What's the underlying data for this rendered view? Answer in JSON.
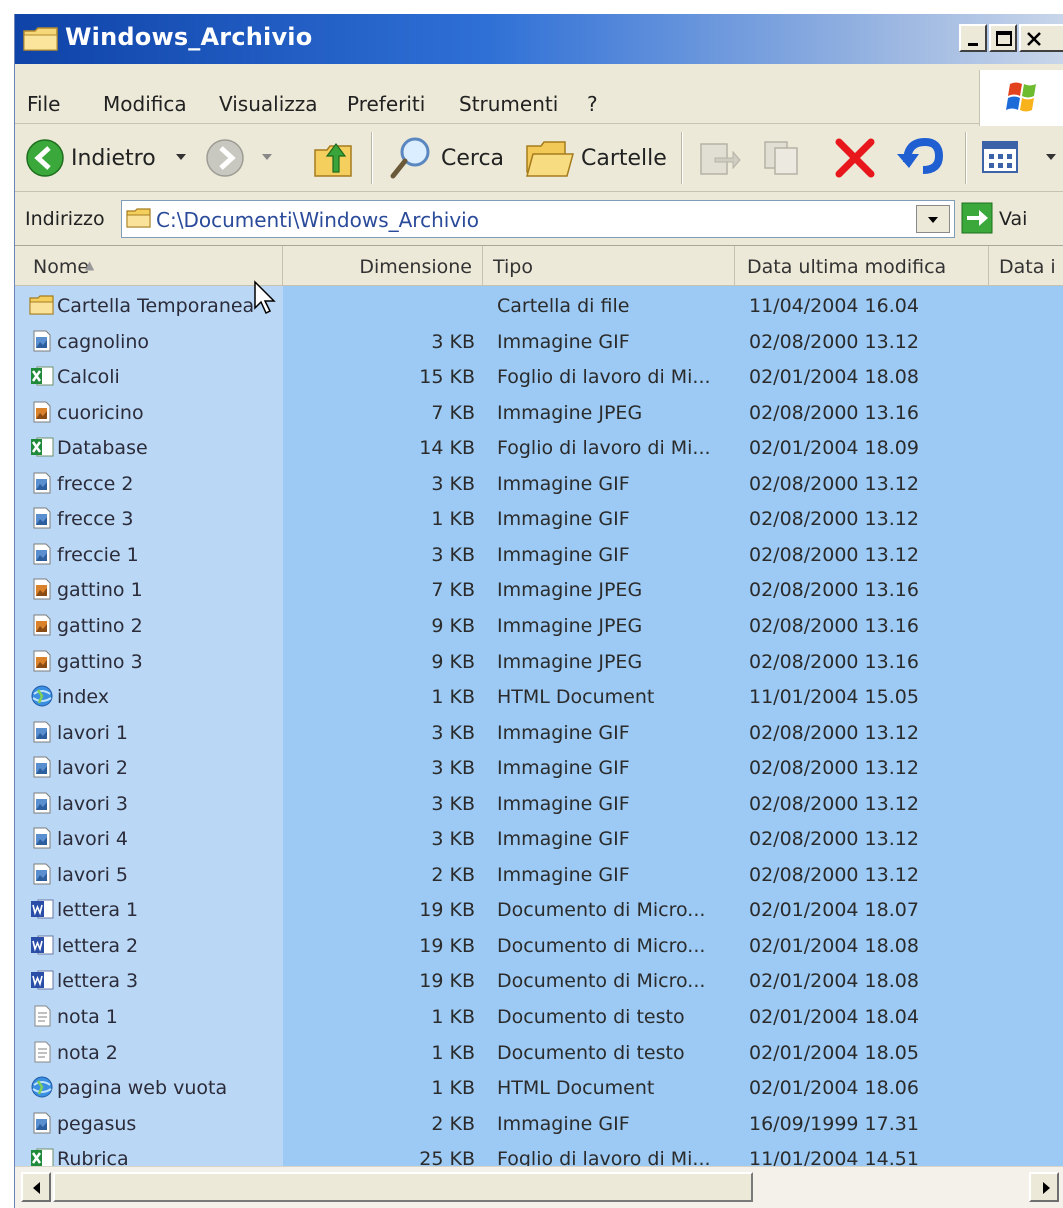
{
  "window": {
    "title": "Windows_Archivio",
    "colors": {
      "title_start": "#0f43a8",
      "title_end": "#c9d6ea",
      "list_background": "#9ccaf4",
      "name_column_background": "#bad8f5",
      "delete_red": "#e8171c"
    }
  },
  "menu": [
    "File",
    "Modifica",
    "Visualizza",
    "Preferiti",
    "Strumenti",
    "?"
  ],
  "toolbar": {
    "back_label": "Indietro",
    "search_label": "Cerca",
    "folders_label": "Cartelle"
  },
  "address": {
    "label": "Indirizzo",
    "path": "C:\\Documenti\\Windows_Archivio",
    "go_label": "Vai"
  },
  "columns": {
    "name": "Nome",
    "size": "Dimensione",
    "type": "Tipo",
    "modified": "Data ultima modifica",
    "created": "Data i"
  },
  "files": [
    {
      "name": "Cartella Temporanea",
      "size": "",
      "type": "Cartella di file",
      "date": "11/04/2004 16.04",
      "icon": "folder-icon"
    },
    {
      "name": "cagnolino",
      "size": "3 KB",
      "type": "Immagine GIF",
      "date": "02/08/2000 13.12",
      "icon": "gif-image-icon"
    },
    {
      "name": "Calcoli",
      "size": "15 KB",
      "type": "Foglio di lavoro di Mi...",
      "date": "02/01/2004 18.08",
      "icon": "excel-icon"
    },
    {
      "name": "cuoricino",
      "size": "7 KB",
      "type": "Immagine JPEG",
      "date": "02/08/2000 13.16",
      "icon": "jpeg-image-icon"
    },
    {
      "name": "Database",
      "size": "14 KB",
      "type": "Foglio di lavoro di Mi...",
      "date": "02/01/2004 18.09",
      "icon": "excel-icon"
    },
    {
      "name": "frecce 2",
      "size": "3 KB",
      "type": "Immagine GIF",
      "date": "02/08/2000 13.12",
      "icon": "gif-image-icon"
    },
    {
      "name": "frecce 3",
      "size": "1 KB",
      "type": "Immagine GIF",
      "date": "02/08/2000 13.12",
      "icon": "gif-image-icon"
    },
    {
      "name": "freccie 1",
      "size": "3 KB",
      "type": "Immagine GIF",
      "date": "02/08/2000 13.12",
      "icon": "gif-image-icon"
    },
    {
      "name": "gattino 1",
      "size": "7 KB",
      "type": "Immagine JPEG",
      "date": "02/08/2000 13.16",
      "icon": "jpeg-image-icon"
    },
    {
      "name": "gattino 2",
      "size": "9 KB",
      "type": "Immagine JPEG",
      "date": "02/08/2000 13.16",
      "icon": "jpeg-image-icon"
    },
    {
      "name": "gattino 3",
      "size": "9 KB",
      "type": "Immagine JPEG",
      "date": "02/08/2000 13.16",
      "icon": "jpeg-image-icon"
    },
    {
      "name": "index",
      "size": "1 KB",
      "type": "HTML Document",
      "date": "11/01/2004 15.05",
      "icon": "html-icon"
    },
    {
      "name": "lavori 1",
      "size": "3 KB",
      "type": "Immagine GIF",
      "date": "02/08/2000 13.12",
      "icon": "gif-image-icon"
    },
    {
      "name": "lavori 2",
      "size": "3 KB",
      "type": "Immagine GIF",
      "date": "02/08/2000 13.12",
      "icon": "gif-image-icon"
    },
    {
      "name": "lavori 3",
      "size": "3 KB",
      "type": "Immagine GIF",
      "date": "02/08/2000 13.12",
      "icon": "gif-image-icon"
    },
    {
      "name": "lavori 4",
      "size": "3 KB",
      "type": "Immagine GIF",
      "date": "02/08/2000 13.12",
      "icon": "gif-image-icon"
    },
    {
      "name": "lavori 5",
      "size": "2 KB",
      "type": "Immagine GIF",
      "date": "02/08/2000 13.12",
      "icon": "gif-image-icon"
    },
    {
      "name": "lettera 1",
      "size": "19 KB",
      "type": "Documento di Micro...",
      "date": "02/01/2004 18.07",
      "icon": "word-icon"
    },
    {
      "name": "lettera 2",
      "size": "19 KB",
      "type": "Documento di Micro...",
      "date": "02/01/2004 18.08",
      "icon": "word-icon"
    },
    {
      "name": "lettera 3",
      "size": "19 KB",
      "type": "Documento di Micro...",
      "date": "02/01/2004 18.08",
      "icon": "word-icon"
    },
    {
      "name": "nota 1",
      "size": "1 KB",
      "type": "Documento di testo",
      "date": "02/01/2004 18.04",
      "icon": "text-file-icon"
    },
    {
      "name": "nota 2",
      "size": "1 KB",
      "type": "Documento di testo",
      "date": "02/01/2004 18.05",
      "icon": "text-file-icon"
    },
    {
      "name": "pagina web vuota",
      "size": "1 KB",
      "type": "HTML Document",
      "date": "02/01/2004 18.06",
      "icon": "html-icon"
    },
    {
      "name": "pegasus",
      "size": "2 KB",
      "type": "Immagine GIF",
      "date": "16/09/1999 17.31",
      "icon": "gif-image-icon"
    },
    {
      "name": "Rubrica",
      "size": "25 KB",
      "type": "Foglio di lavoro di Mi...",
      "date": "11/01/2004 14.51",
      "icon": "excel-icon"
    }
  ]
}
